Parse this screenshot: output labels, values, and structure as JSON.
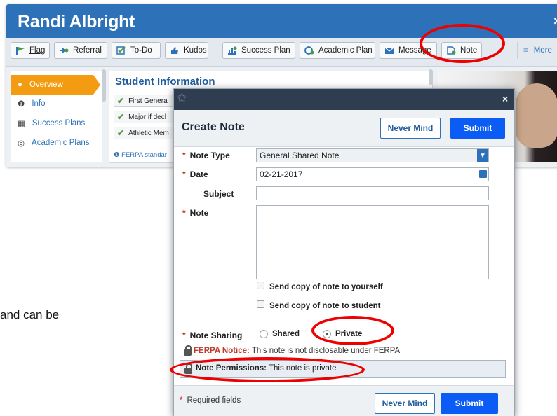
{
  "profile": {
    "name": "Randi Albright",
    "close_glyph": "×",
    "toolbar": {
      "buttons": [
        {
          "label": "Flag",
          "icon": "flag-icon"
        },
        {
          "label": "Referral",
          "icon": "referral-icon"
        },
        {
          "label": "To-Do",
          "icon": "todo-icon"
        },
        {
          "label": "Kudos",
          "icon": "kudos-icon"
        },
        {
          "label": "Success Plan",
          "icon": "success-plan-icon"
        },
        {
          "label": "Academic Plan",
          "icon": "academic-plan-icon"
        },
        {
          "label": "Message",
          "icon": "message-icon"
        },
        {
          "label": "Note",
          "icon": "note-icon"
        }
      ],
      "more_label": "More"
    },
    "nav": {
      "items": [
        {
          "label": "Overview",
          "icon": "person-icon"
        },
        {
          "label": "Info",
          "icon": "info-icon"
        },
        {
          "label": "Success Plans",
          "icon": "success-plans-icon"
        },
        {
          "label": "Academic Plans",
          "icon": "academic-plans-icon"
        }
      ]
    },
    "student_info": {
      "title": "Student Information",
      "rows": [
        "First Genera",
        "Major if decl",
        "Athletic Mem"
      ],
      "ferpa_std": "FERPA standar"
    }
  },
  "fragment_text": "and can be",
  "modal": {
    "title": "Create Note",
    "close_glyph": "×",
    "never_mind_label": "Never Mind",
    "submit_label": "Submit",
    "labels": {
      "note_type": "Note Type",
      "date": "Date",
      "subject": "Subject",
      "note": "Note",
      "note_sharing": "Note Sharing"
    },
    "values": {
      "note_type": "General Shared Note",
      "date": "02-21-2017",
      "subject": "",
      "note": ""
    },
    "checkboxes": {
      "copy_self": "Send copy of note to yourself",
      "copy_student": "Send copy of note to student"
    },
    "sharing": {
      "shared_label": "Shared",
      "private_label": "Private",
      "selected": "Private"
    },
    "ferpa": {
      "notice_label": "FERPA Notice:",
      "notice_text": " This note is not disclosable under FERPA"
    },
    "permissions": {
      "label": "Note Permissions:",
      "text": " This note is private"
    },
    "required_text": "Required fields",
    "required_glyph": "*"
  },
  "colors": {
    "header_blue": "#2d72b8",
    "accent_orange": "#f39c12",
    "submit_blue": "#0a5cf5",
    "annotation_red": "#e00000",
    "modal_header": "#2e3e50"
  }
}
